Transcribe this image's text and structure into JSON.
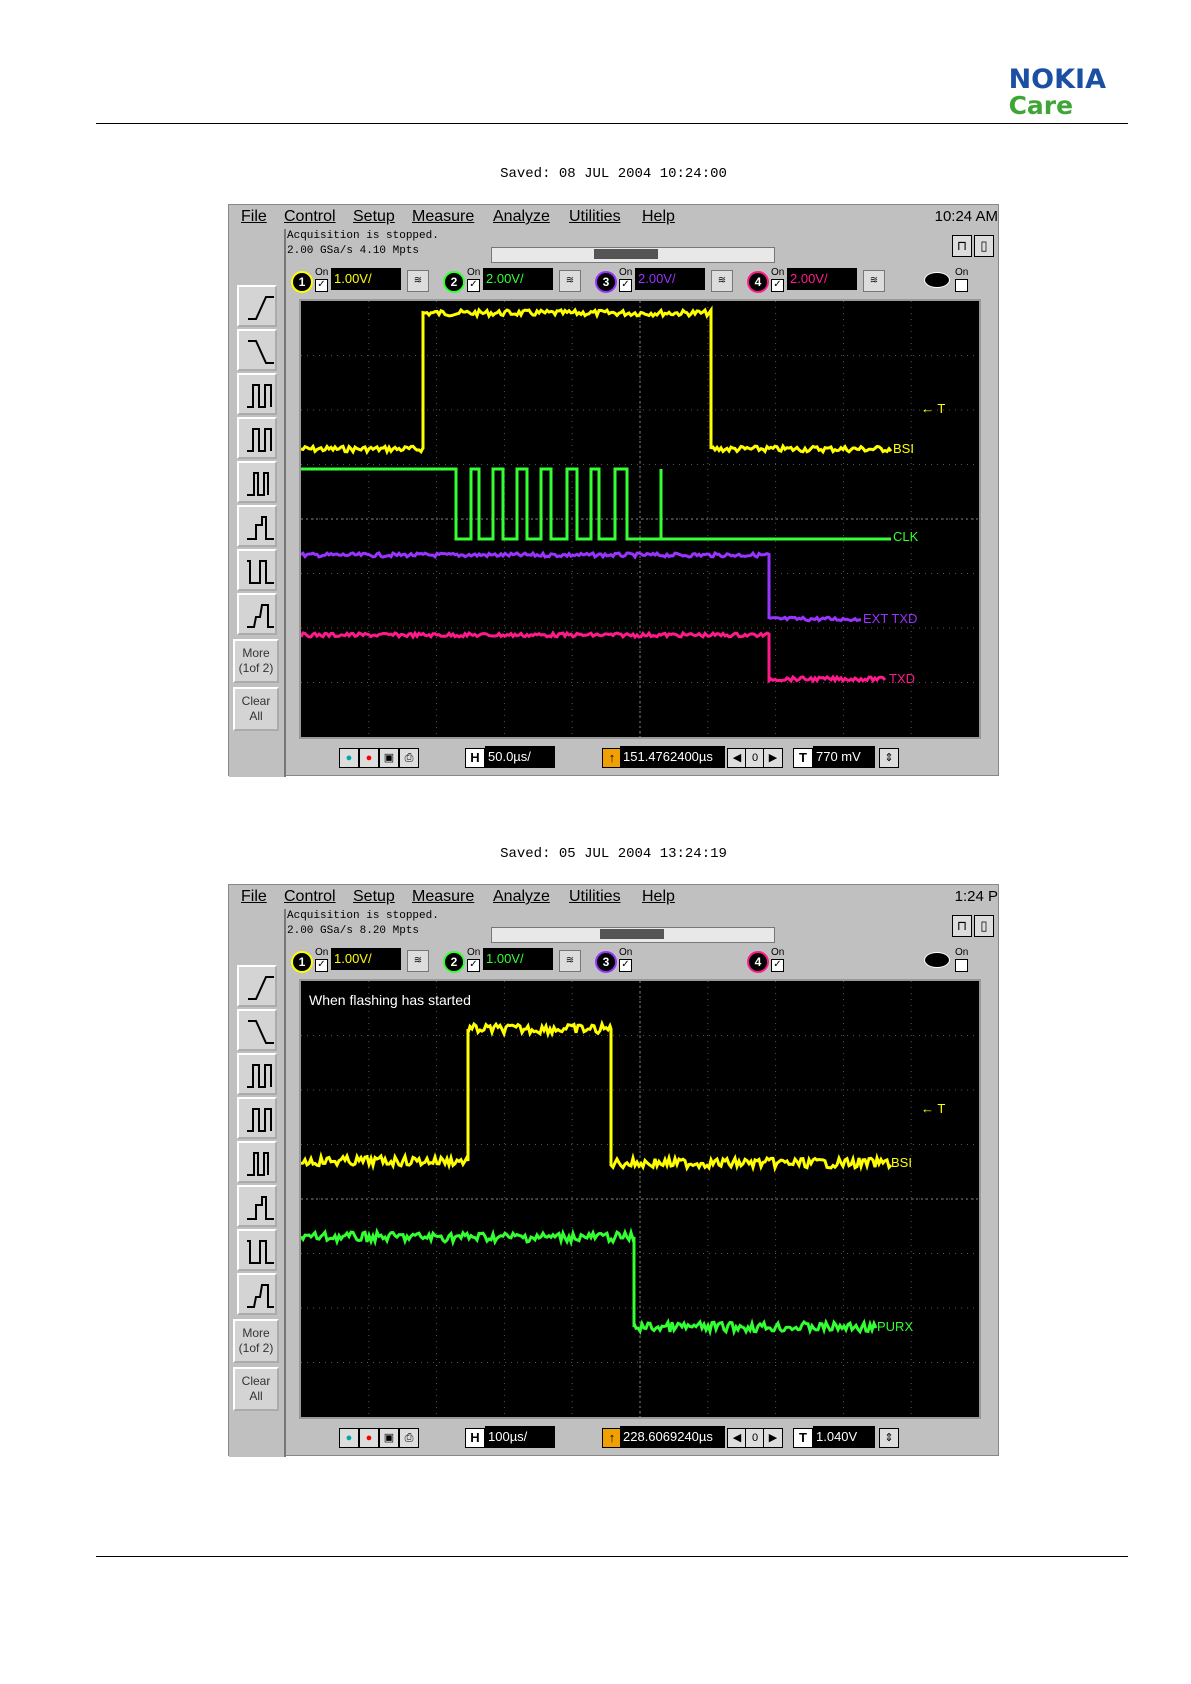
{
  "header": {
    "brand": "NOKIA",
    "subbrand": "Care"
  },
  "screenshots": [
    {
      "saved": "Saved:  08 JUL 2004   10:24:00",
      "menu": [
        "File",
        "Control",
        "Setup",
        "Measure",
        "Analyze",
        "Utilities",
        "Help"
      ],
      "clock": "10:24 AM",
      "acq_line1": "Acquisition is stopped.",
      "acq_line2": "2.00 GSa/s    4.10 Mpts",
      "channels": [
        {
          "num": "1",
          "on": "On",
          "scale": "1.00V/",
          "color": "#ffff00"
        },
        {
          "num": "2",
          "on": "On",
          "scale": "2.00V/",
          "color": "#33ff33"
        },
        {
          "num": "3",
          "on": "On",
          "scale": "2.00V/",
          "color": "#9933ff"
        },
        {
          "num": "4",
          "on": "On",
          "scale": "2.00V/",
          "color": "#ff1a8c"
        }
      ],
      "extra_on": "On",
      "more": "More\n(1of 2)",
      "clear": "Clear\nAll",
      "annotation": "",
      "trace_labels": [
        "BSI",
        "CLK",
        "EXT TXD",
        "TXD"
      ],
      "trigger_mark": "← T",
      "timebase": "50.0µs/",
      "delay": "151.4762400µs",
      "delay_digit": "0",
      "trigger_level": "770 mV"
    },
    {
      "saved": "Saved:  05 JUL 2004   13:24:19",
      "menu": [
        "File",
        "Control",
        "Setup",
        "Measure",
        "Analyze",
        "Utilities",
        "Help"
      ],
      "clock": "1:24 P",
      "acq_line1": "Acquisition is stopped.",
      "acq_line2": "2.00 GSa/s    8.20 Mpts",
      "channels": [
        {
          "num": "1",
          "on": "On",
          "scale": "1.00V/",
          "color": "#ffff00"
        },
        {
          "num": "2",
          "on": "On",
          "scale": "1.00V/",
          "color": "#33ff33"
        },
        {
          "num": "3",
          "on": "On",
          "scale": "",
          "color": "#9933ff"
        },
        {
          "num": "4",
          "on": "On",
          "scale": "",
          "color": "#ff1a8c"
        }
      ],
      "extra_on": "On",
      "more": "More\n(1of 2)",
      "clear": "Clear\nAll",
      "annotation": "When flashing has started",
      "trace_labels": [
        "BSI",
        "PURX"
      ],
      "trigger_mark": "← T",
      "timebase": "100µs/",
      "delay": "228.6069240µs",
      "delay_digit": "0",
      "trigger_level": "1.040V"
    }
  ]
}
